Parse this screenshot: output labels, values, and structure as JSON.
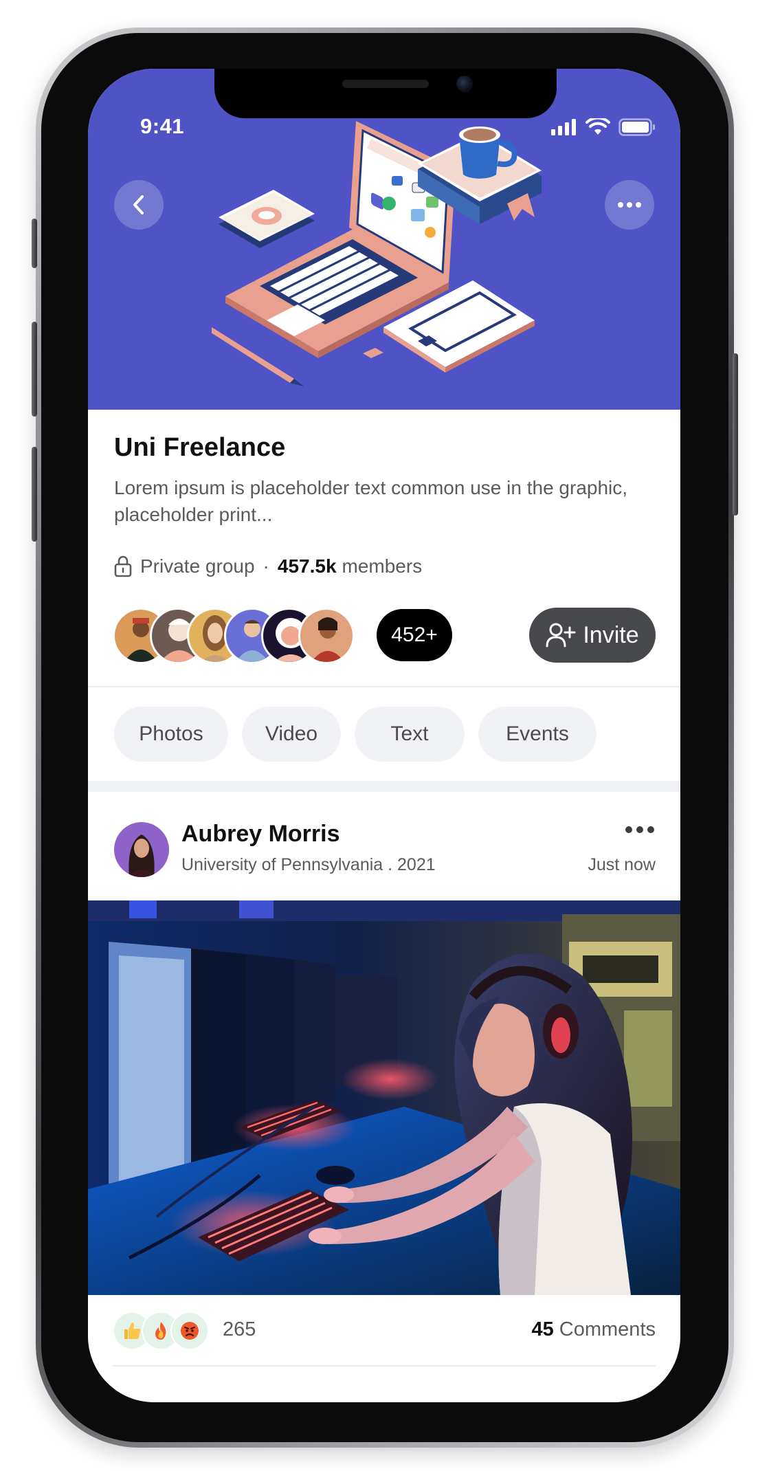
{
  "status_bar": {
    "time": "9:41",
    "icons": [
      "cellular-signal-icon",
      "wifi-icon",
      "battery-icon"
    ]
  },
  "header": {
    "back_icon": "chevron-left-icon",
    "more_icon": "ellipsis-icon",
    "banner_color": "#4F53C5"
  },
  "group": {
    "name": "Uni Freelance",
    "description": "Lorem ipsum is placeholder text common use in the graphic, placeholder print...",
    "privacy": "Private group",
    "separator": "·",
    "members_count": "457.5k",
    "members_label": "members",
    "member_avatars_more": "452+",
    "invite_label": "Invite"
  },
  "filters": [
    {
      "label": "Photos"
    },
    {
      "label": "Video"
    },
    {
      "label": "Text"
    },
    {
      "label": "Events"
    }
  ],
  "post": {
    "author": "Aubrey Morris",
    "subtitle": "University of Pennsylvania . 2021",
    "time": "Just now",
    "reactions": [
      "thumbs-up-icon",
      "fire-icon",
      "angry-face-icon"
    ],
    "reaction_count": "265",
    "comments_count": "45",
    "comments_label": "Comments"
  },
  "colors": {
    "accent": "#4F53C5",
    "invite_button": "#47484C",
    "chip_bg": "#F1F2F5",
    "reaction_bg": "#E3F3E9"
  }
}
